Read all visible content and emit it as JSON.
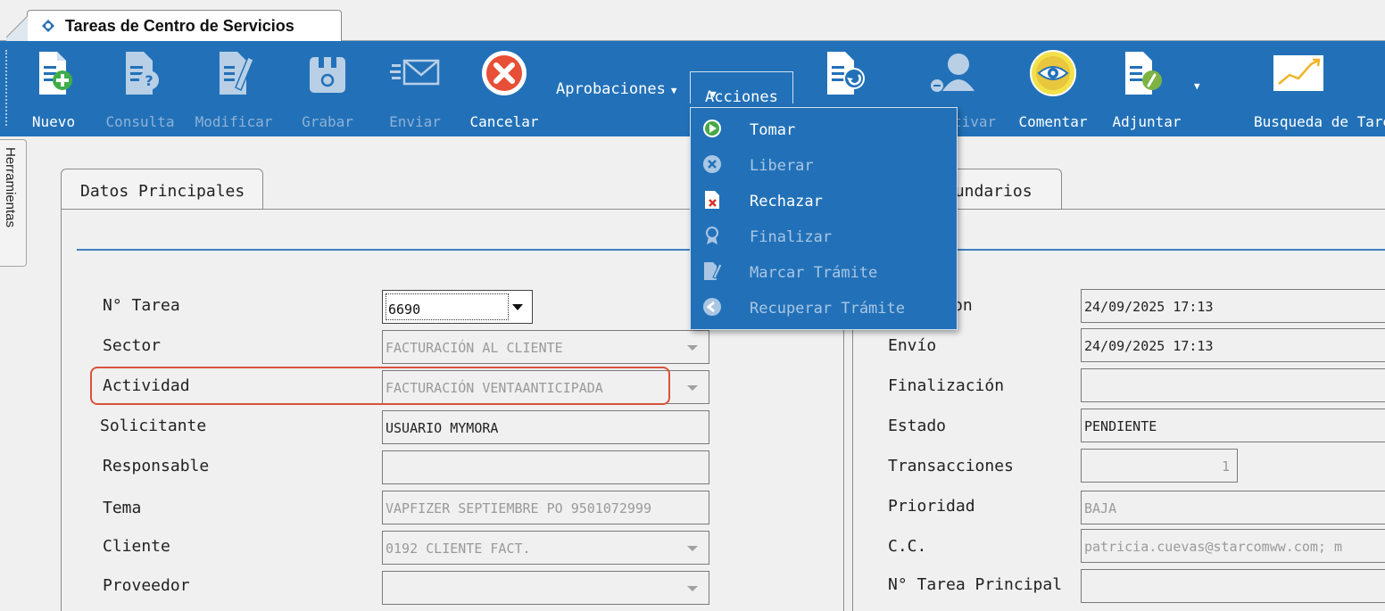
{
  "window": {
    "title": "Tareas de Centro de Servicios"
  },
  "toolbar": {
    "buttons": [
      {
        "label": "Nuevo",
        "icon": "document-add-icon",
        "enabled": true
      },
      {
        "label": "Consulta",
        "icon": "document-query-icon",
        "enabled": false
      },
      {
        "label": "Modificar",
        "icon": "document-edit-icon",
        "enabled": false
      },
      {
        "label": "Grabar",
        "icon": "save-icon",
        "enabled": false
      },
      {
        "label": "Enviar",
        "icon": "mail-send-icon",
        "enabled": false
      },
      {
        "label": "Cancelar",
        "icon": "cancel-icon",
        "enabled": true
      },
      {
        "label": "tivar",
        "icon": "user-icon",
        "enabled": false
      },
      {
        "label": "Comentar",
        "icon": "eye-icon",
        "enabled": true
      },
      {
        "label": "Adjuntar",
        "icon": "attach-icon",
        "enabled": true
      },
      {
        "label": "Busqueda de Tareas",
        "icon": "chart-search-icon",
        "enabled": true
      }
    ],
    "aprobaciones_label": "Aprobaciones",
    "acciones_label": "Acciones"
  },
  "acciones_menu": [
    {
      "label": "Tomar",
      "icon": "play-icon",
      "enabled": true
    },
    {
      "label": "Liberar",
      "icon": "x-circle-icon",
      "enabled": false
    },
    {
      "label": "Rechazar",
      "icon": "document-reject-icon",
      "enabled": true
    },
    {
      "label": "Finalizar",
      "icon": "ribbon-icon",
      "enabled": false
    },
    {
      "label": "Marcar Trámite",
      "icon": "document-mark-icon",
      "enabled": false
    },
    {
      "label": "Recuperar Trámite",
      "icon": "arrow-back-icon",
      "enabled": false
    }
  ],
  "side_tab": {
    "label": "Herramientas"
  },
  "panels": {
    "left_tab": "Datos Principales",
    "right_tab": "cundarios"
  },
  "left_fields": {
    "tarea": {
      "label": "N° Tarea",
      "value": "6690"
    },
    "sector": {
      "label": "Sector",
      "value": "FACTURACIÓN AL CLIENTE"
    },
    "actividad": {
      "label": "Actividad",
      "value": "FACTURACIÓN VENTAANTICIPADA"
    },
    "solicitante": {
      "label": "Solicitante",
      "value": "USUARIO MYMORA"
    },
    "responsable": {
      "label": "Responsable",
      "value": ""
    },
    "tema": {
      "label": "Tema",
      "value": "VAPFIZER SEPTIEMBRE PO 9501072999"
    },
    "cliente": {
      "label": "Cliente",
      "value": "0192 CLIENTE FACT."
    },
    "proveedor": {
      "label": "Proveedor",
      "value": ""
    }
  },
  "right_fields": {
    "creacion": {
      "label": "on",
      "value": "24/09/2025 17:13"
    },
    "envio": {
      "label": "Envío",
      "value": "24/09/2025 17:13"
    },
    "finalizacion": {
      "label": "Finalización",
      "value": ""
    },
    "estado": {
      "label": "Estado",
      "value": "PENDIENTE"
    },
    "transacciones": {
      "label": "Transacciones",
      "value": "1"
    },
    "prioridad": {
      "label": "Prioridad",
      "value": "BAJA"
    },
    "cc": {
      "label": "C.C.",
      "value": "patricia.cuevas@starcomww.com; m"
    },
    "tarea_principal": {
      "label": "N° Tarea Principal",
      "value": ""
    }
  },
  "colors": {
    "toolbar": "#2271b8",
    "highlight": "#d9533c"
  }
}
